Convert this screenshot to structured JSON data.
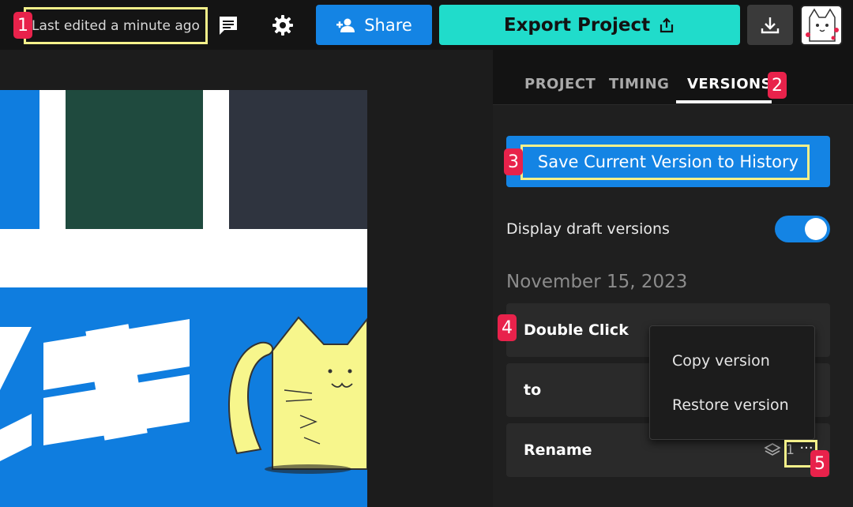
{
  "topbar": {
    "last_edited": "Last edited a minute ago",
    "share_label": "Share",
    "export_label": "Export Project",
    "icons": [
      "comment-icon",
      "gear-icon",
      "add-person-icon",
      "share-export-icon",
      "download-icon",
      "cat-avatar"
    ]
  },
  "panel": {
    "tabs": [
      {
        "label": "PROJECT",
        "active": false
      },
      {
        "label": "TIMING",
        "active": false
      },
      {
        "label": "VERSIONS",
        "active": true
      }
    ],
    "save_button": "Save Current Version to History",
    "draft_toggle": {
      "label": "Display draft versions",
      "on": true
    },
    "date_heading": "November 15, 2023",
    "versions": [
      {
        "name": "Double Click"
      },
      {
        "name": "to"
      },
      {
        "name": "Rename",
        "layers": "1"
      }
    ]
  },
  "context_menu": {
    "items": [
      "Copy version",
      "Restore version"
    ]
  },
  "annotations": {
    "badges": [
      "1",
      "2",
      "3",
      "4",
      "5"
    ]
  },
  "colors": {
    "share_blue": "#1484e4",
    "export_teal": "#20dccb",
    "badge_red": "#e8224b",
    "highlight_yellow": "#f4f08a",
    "preview_blue": "#0f7ddf",
    "cat_yellow": "#f7f68c"
  }
}
